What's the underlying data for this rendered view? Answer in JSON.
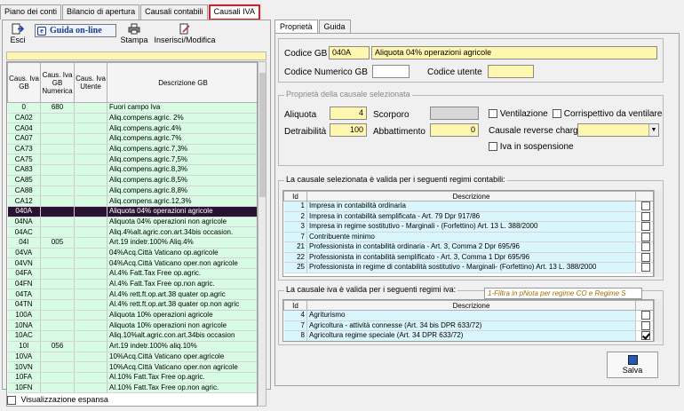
{
  "tabs": [
    "Piano dei conti",
    "Bilancio di apertura",
    "Causali contabili",
    "Causali IVA"
  ],
  "toolbar": {
    "esci": "Esci",
    "guida": "Guida on-line",
    "stampa": "Stampa",
    "inserisci": "Inserisci/Modifica"
  },
  "grid": {
    "headers": [
      "Caus. Iva GB",
      "Caus. Iva GB Numerica",
      "Caus. Iva Utente",
      "Descrizione GB"
    ],
    "rows": [
      [
        "0",
        "680",
        "",
        "Fuori campo Iva"
      ],
      [
        "CA02",
        "",
        "",
        "Aliq.compens.agric. 2%"
      ],
      [
        "CA04",
        "",
        "",
        "Aliq.compens.agric.4%"
      ],
      [
        "CA07",
        "",
        "",
        "Aliq.compens.agric.7%"
      ],
      [
        "CA73",
        "",
        "",
        "Aliq.compens.agric.7,3%"
      ],
      [
        "CA75",
        "",
        "",
        "Aliq.compens.agric.7,5%"
      ],
      [
        "CA83",
        "",
        "",
        "Aliq.compens.agric.8,3%"
      ],
      [
        "CA85",
        "",
        "",
        "Aliq.compens.agric.8,5%"
      ],
      [
        "CA88",
        "",
        "",
        "Aliq.compens.agric.8,8%"
      ],
      [
        "CA12",
        "",
        "",
        "Aliq.compens.agric.12,3%"
      ],
      [
        "040A",
        "",
        "",
        "Aliquota 04% operazioni agricole"
      ],
      [
        "04NA",
        "",
        "",
        "Aliquota 04% operazioni non agricole"
      ],
      [
        "04AC",
        "",
        "",
        "Aliq.4%alt.agric.con.art.34bis occasion."
      ],
      [
        "04I",
        "005",
        "",
        "Art.19 indetr.100% Aliq.4%"
      ],
      [
        "04VA",
        "",
        "",
        "04%Acq.Città Vaticano op.agricole"
      ],
      [
        "04VN",
        "",
        "",
        "04%Acq.Città Vaticano oper.non agricole"
      ],
      [
        "04FA",
        "",
        "",
        "Al.4% Fatt.Tax Free op.agric."
      ],
      [
        "04FN",
        "",
        "",
        "Al.4% Fatt.Tax Free op.non agric."
      ],
      [
        "04TA",
        "",
        "",
        "Al.4% rett.ft.op.art.38 quater op.agric"
      ],
      [
        "04TN",
        "",
        "",
        "Al.4% rett.ft.op.art.38 quater op.non agric"
      ],
      [
        "100A",
        "",
        "",
        "Aliquota 10% operazioni agricole"
      ],
      [
        "10NA",
        "",
        "",
        "Aliquota 10% operazioni non agricole"
      ],
      [
        "10AC",
        "",
        "",
        "Aliq.10%alt.agric.con.art.34bis occasion"
      ],
      [
        "10I",
        "056",
        "",
        "Art.19 indetr.100% aliq.10%"
      ],
      [
        "10VA",
        "",
        "",
        "10%Acq.Città Vaticano oper.agricole"
      ],
      [
        "10VN",
        "",
        "",
        "10%Acq.Città Vaticano oper.non agricole"
      ],
      [
        "10FA",
        "",
        "",
        "Al.10% Fatt.Tax Free op.agric."
      ],
      [
        "10FN",
        "",
        "",
        "Al.10% Fatt.Tax Free op.non agric."
      ]
    ],
    "selected_index": 10
  },
  "expand_label": "Visualizzazione espansa",
  "right_tabs": [
    "Proprietà",
    "Guida"
  ],
  "props": {
    "codice_gb_label": "Codice GB",
    "codice_gb_code": "040A",
    "codice_gb_desc": "Aliquota 04% operazioni agricole",
    "codice_num_label": "Codice Numerico GB",
    "codice_utente_label": "Codice utente"
  },
  "causale": {
    "title": "Proprietà della causale selezionata",
    "aliquota_label": "Aliquota",
    "aliquota": "4",
    "detraibilita_label": "Detraibilità",
    "detraibilita": "100",
    "scorporo_label": "Scorporo",
    "abbattimento_label": "Abbattimento",
    "abbattimento": "0",
    "ventilazione": "Ventilazione",
    "corrispettivo": "Corrispettivo da ventilare",
    "reverse_label": "Causale reverse charge",
    "iva_sosp": "Iva in sospensione"
  },
  "regimi": {
    "title": "La causale selezionata è valida per i seguenti regimi contabili:",
    "headers": [
      "Id",
      "Descrizione"
    ],
    "rows": [
      [
        "1",
        "Impresa  in contabilità ordinaria",
        false
      ],
      [
        "2",
        "Impresa  in contabilità semplificata - Art. 79 Dpr 917/86",
        false
      ],
      [
        "3",
        "Impresa in regime sostitutivo - Marginali - (Forfettino) Art. 13 L. 388/2000",
        false
      ],
      [
        "7",
        "Contribuente minimo",
        false
      ],
      [
        "21",
        "Professionista in contabilità ordinaria - Art. 3, Comma 2 Dpr 695/96",
        false
      ],
      [
        "22",
        "Professionista in contabilità semplificato - Art. 3, Comma 1 Dpr 695/96",
        false
      ],
      [
        "25",
        "Professionista in regime di contabilità sostitutivo - Marginali- (Forfettino) Art. 13 L. 388/2000",
        false
      ]
    ]
  },
  "regimi_iva": {
    "title": "La causale iva è valida per i seguenti regimi iva:",
    "filter": "1-Filtra in pNota per regime CO e Regime S",
    "headers": [
      "Id",
      "Descrizione"
    ],
    "rows": [
      [
        "4",
        "Agriturismo",
        false
      ],
      [
        "7",
        "Agricoltura - attività connesse (Art. 34 bis DPR 633/72)",
        false
      ],
      [
        "8",
        "Agricoltura regime speciale (Art. 34 DPR 633/72)",
        true
      ]
    ]
  },
  "salva": "Salva"
}
